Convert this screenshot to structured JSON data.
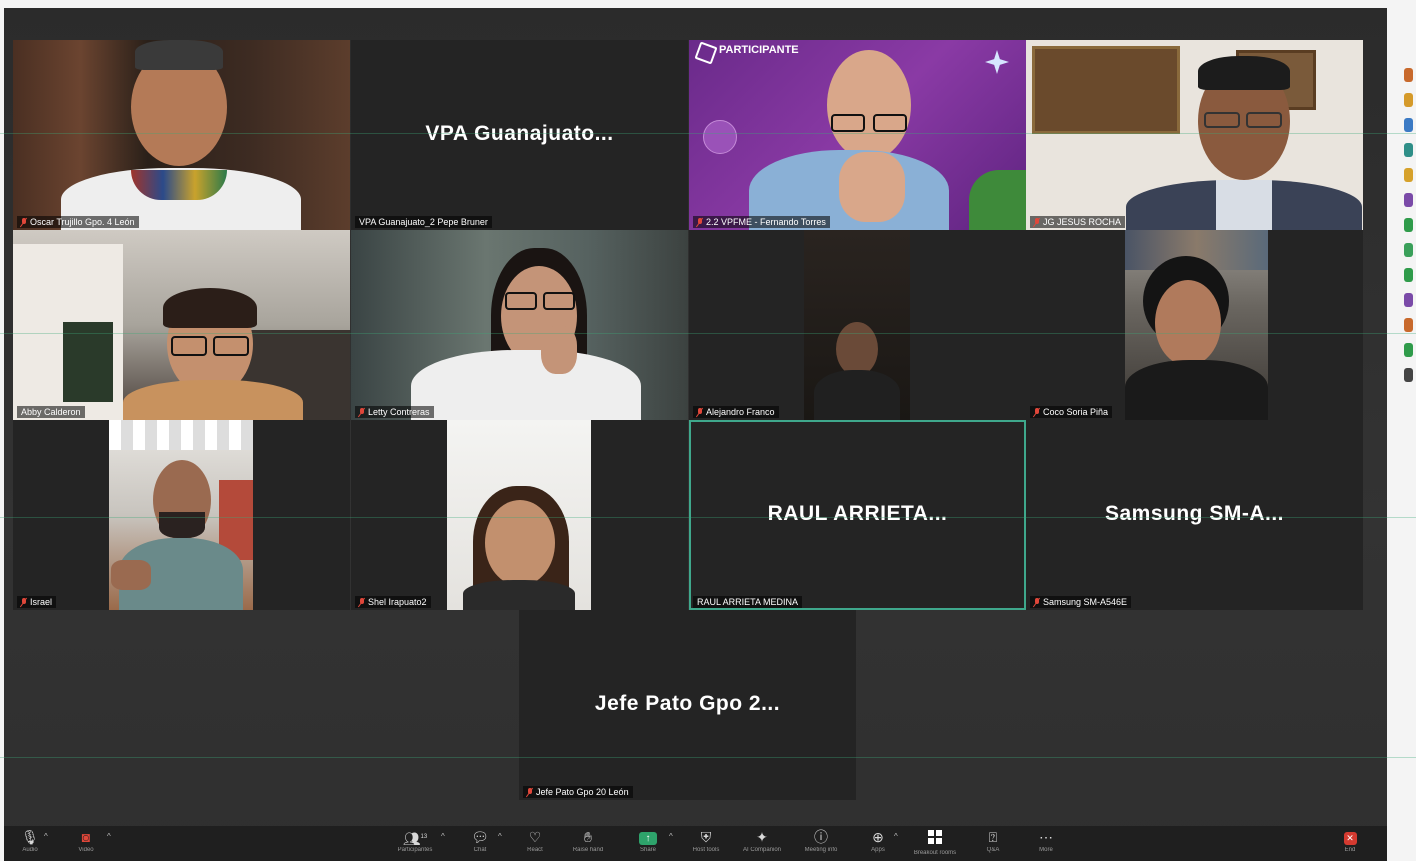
{
  "tiles": [
    {
      "id": "oscar",
      "label": "Oscar Trujillo Gpo. 4 León",
      "muted": true
    },
    {
      "id": "vpa",
      "display_name": "VPA Guanajuato...",
      "label": "VPA Guanajuato_2 Pepe Bruner",
      "muted": false
    },
    {
      "id": "fernando",
      "label": "2.2 VPFME - Fernando Torres",
      "muted": true,
      "poster_text": "PARTICIPANTE"
    },
    {
      "id": "jesus",
      "label": "JG JESUS ROCHA",
      "muted": true
    },
    {
      "id": "abby",
      "label": "Abby Calderon",
      "muted": false
    },
    {
      "id": "letty",
      "label": "Letty Contreras",
      "muted": true
    },
    {
      "id": "alejandro",
      "label": "Alejandro Franco",
      "muted": true
    },
    {
      "id": "coco",
      "label": "Coco Soria Piña",
      "muted": true
    },
    {
      "id": "israel",
      "label": "Israel",
      "muted": true
    },
    {
      "id": "shel",
      "label": "Shel Irapuato2",
      "muted": true
    },
    {
      "id": "raul",
      "display_name": "RAUL ARRIETA...",
      "label": "RAUL ARRIETA MEDINA",
      "muted": false,
      "active": true
    },
    {
      "id": "samsung",
      "display_name": "Samsung SM-A...",
      "label": "Samsung SM-A546E",
      "muted": true
    },
    {
      "id": "jefe",
      "display_name": "Jefe Pato Gpo 2...",
      "label": "Jefe Pato Gpo 20 León",
      "muted": true
    }
  ],
  "toolbar": {
    "audio": {
      "label": "Audio",
      "icon": "microphone-icon"
    },
    "video": {
      "label": "Video",
      "icon": "video-off-icon"
    },
    "participants": {
      "label": "Participantes",
      "count": "13",
      "icon": "participants-icon"
    },
    "chat": {
      "label": "Chat",
      "icon": "chat-icon"
    },
    "react": {
      "label": "React",
      "icon": "heart-icon"
    },
    "raise_hand": {
      "label": "Raise hand",
      "icon": "hand-icon"
    },
    "share": {
      "label": "Share",
      "icon": "share-screen-icon"
    },
    "host_tools": {
      "label": "Host tools",
      "icon": "shield-icon"
    },
    "ai_companion": {
      "label": "AI Companion",
      "icon": "sparkle-icon"
    },
    "meeting_info": {
      "label": "Meeting info",
      "icon": "info-icon"
    },
    "apps": {
      "label": "Apps",
      "icon": "apps-icon"
    },
    "breakout_rooms": {
      "label": "Breakout rooms",
      "icon": "grid-icon"
    },
    "qa": {
      "label": "Q&A",
      "icon": "qa-icon"
    },
    "more": {
      "label": "More",
      "icon": "more-icon"
    },
    "end": {
      "label": "End",
      "icon": "close-icon"
    }
  },
  "colors": {
    "stage": "#2b2b2b",
    "tile": "#242424",
    "active_border": "#3fa88c",
    "share": "#2ea36b",
    "end": "#d43a30",
    "muted_mic": "#e0473a"
  },
  "reaction_strip_colors": [
    "#c8692c",
    "#d59a2a",
    "#3b7ac4",
    "#2f8f88",
    "#d6a12b",
    "#7a4aa8",
    "#2f9b4a",
    "#3aa05a",
    "#2f9b4a",
    "#7a4aa8",
    "#c8692c",
    "#2f9b4a",
    "#444444"
  ]
}
